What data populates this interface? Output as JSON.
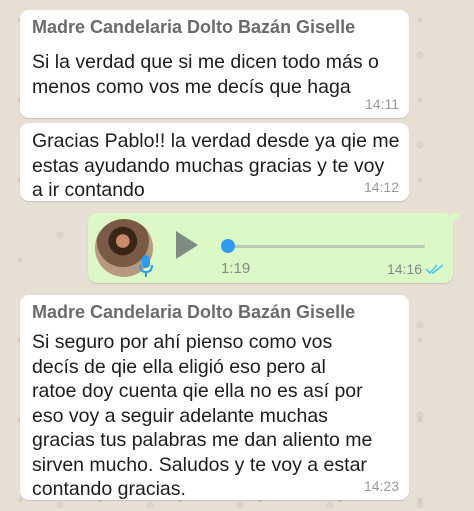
{
  "messages": [
    {
      "sender": "Madre Candelaria Dolto Bazán Giselle",
      "lines": [
        "Si la verdad que si me dicen todo más o",
        "menos como vos me decís que haga"
      ],
      "time": "14:11"
    },
    {
      "lines": [
        "Gracias Pablo!! la verdad desde ya qie me",
        "estas ayudando muchas gracias y te voy",
        "a ir contando"
      ],
      "time": "14:12"
    },
    {
      "sender": "Madre Candelaria Dolto Bazán Giselle",
      "lines": [
        "Si seguro por ahí pienso como vos",
        "decís de qie ella eligió eso pero al",
        "ratoe doy cuenta qie ella no es así por",
        "eso voy a seguir adelante muchas",
        "gracias tus palabras me dan aliento me",
        "sirven mucho. Saludos y te voy a estar",
        "contando gracias."
      ],
      "time": "14:23"
    }
  ],
  "audio": {
    "duration": "1:19",
    "time": "14:16",
    "progress": 0.0,
    "status": "read",
    "colors": {
      "bubble": "#dcf8c6",
      "knob": "#2d9bf0",
      "ticks": "#4fc3f7"
    }
  }
}
